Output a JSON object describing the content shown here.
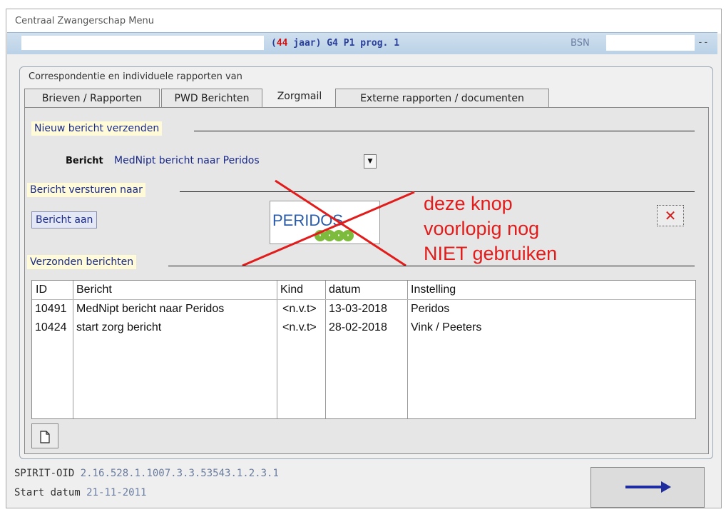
{
  "window": {
    "title": "Centraal Zwangerschap Menu"
  },
  "patient": {
    "age_open": "(",
    "age_num": "44",
    "age_rest": " jaar) G4 P1 prog. 1",
    "bsn_label": "BSN",
    "bsn_tail": "--"
  },
  "panel": {
    "title": "Correspondentie en individuele rapporten van",
    "tabs": [
      "Brieven / Rapporten",
      "PWD Berichten",
      "Zorgmail",
      "Externe rapporten / documenten"
    ],
    "active_tab": "Zorgmail"
  },
  "new_message": {
    "group_label": "Nieuw bericht verzenden",
    "field_label": "Bericht",
    "selected": "MedNipt bericht naar Peridos",
    "dropdown_icon": "chevron-down-icon"
  },
  "send_to": {
    "group_label": "Bericht versturen naar",
    "button_label": "Bericht aan",
    "logo_text": "PERIDOS",
    "annotation": [
      "deze knop",
      "voorlopig nog",
      "NIET gebruiken"
    ],
    "annotation_color": "#e21b1b",
    "delete_icon": "close-icon"
  },
  "sent": {
    "group_label": "Verzonden berichten",
    "columns": [
      "ID",
      "Bericht",
      "Kind",
      "datum",
      "Instelling"
    ],
    "rows": [
      [
        "10491",
        "MedNipt bericht naar Peridos",
        "<n.v.t>",
        "13-03-2018",
        "Peridos"
      ],
      [
        "10424",
        "start zorg bericht",
        "<n.v.t>",
        "28-02-2018",
        "Vink / Peeters"
      ]
    ],
    "new_icon": "new-document-icon"
  },
  "footer": {
    "oid_label": "SPIRIT-OID",
    "oid_value": "2.16.528.1.1007.3.3.53543.1.2.3.1",
    "start_label": "Start datum",
    "start_value": "21-11-2011",
    "next_icon": "arrow-right-icon",
    "arrow_color": "#1f2d9e"
  }
}
